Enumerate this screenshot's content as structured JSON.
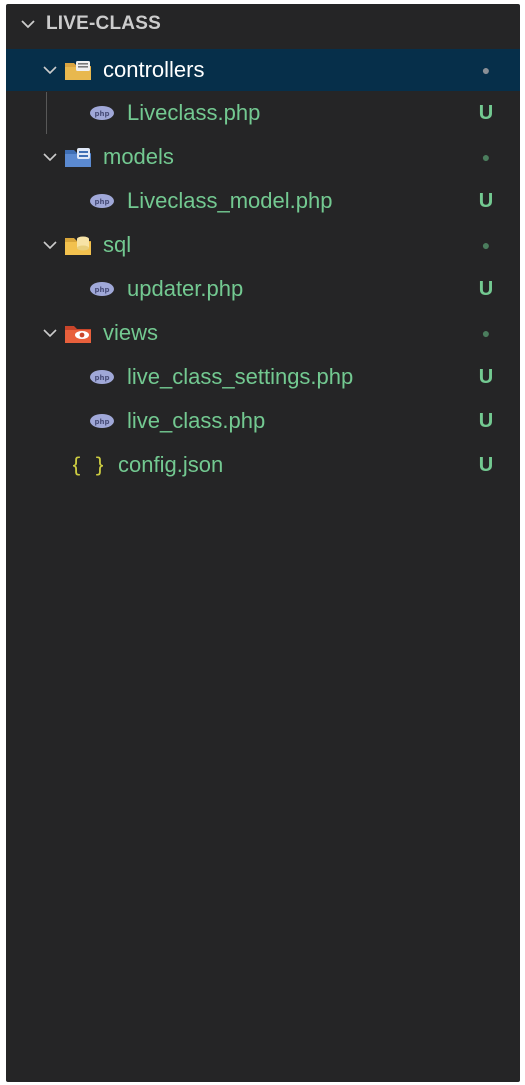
{
  "explorer": {
    "title": "LIVE-CLASS",
    "items": [
      {
        "label": "controllers",
        "type": "folder",
        "status": "●",
        "icon": "controllers-folder-icon"
      },
      {
        "label": "Liveclass.php",
        "type": "file",
        "status": "U",
        "icon": "php-file-icon"
      },
      {
        "label": "models",
        "type": "folder",
        "status": "●",
        "icon": "models-folder-icon"
      },
      {
        "label": "Liveclass_model.php",
        "type": "file",
        "status": "U",
        "icon": "php-file-icon"
      },
      {
        "label": "sql",
        "type": "folder",
        "status": "●",
        "icon": "sql-folder-icon"
      },
      {
        "label": "updater.php",
        "type": "file",
        "status": "U",
        "icon": "php-file-icon"
      },
      {
        "label": "views",
        "type": "folder",
        "status": "●",
        "icon": "views-folder-icon"
      },
      {
        "label": "live_class_settings.php",
        "type": "file",
        "status": "U",
        "icon": "php-file-icon"
      },
      {
        "label": "live_class.php",
        "type": "file",
        "status": "U",
        "icon": "php-file-icon"
      },
      {
        "label": "config.json",
        "type": "file",
        "status": "U",
        "icon": "json-braces-icon"
      }
    ]
  },
  "colors": {
    "background": "#252526",
    "selection": "#062f4a",
    "untracked_green": "#73c991",
    "json_braces": "#cbcb41",
    "php_icon": "#a0a8d8"
  }
}
